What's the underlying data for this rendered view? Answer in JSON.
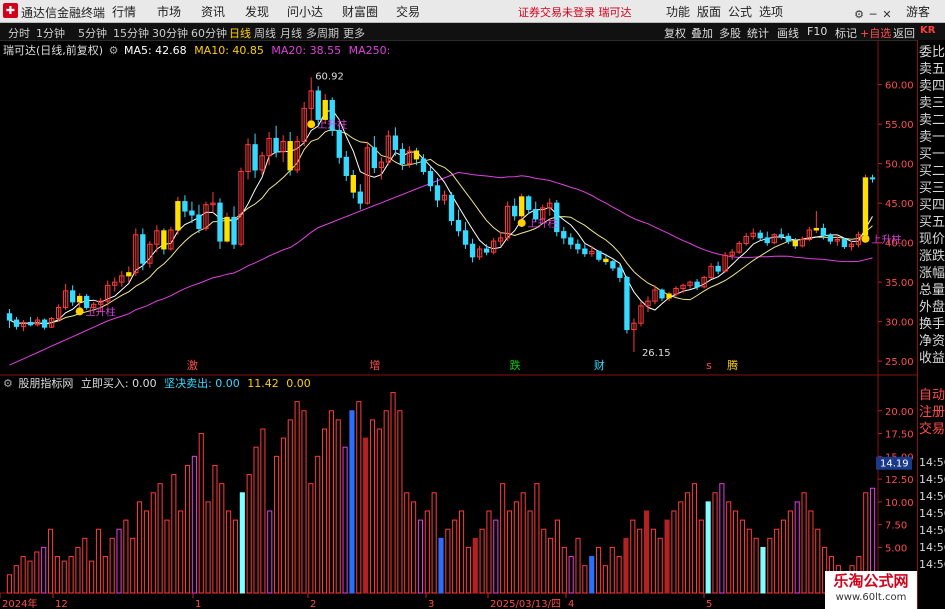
{
  "titlebar": {
    "app_name": "通达信金融终端",
    "menus": [
      "行情",
      "市场",
      "资讯",
      "发现",
      "问小达",
      "财富圈",
      "交易"
    ],
    "warning": "证券交易未登录  瑞可达",
    "right_menus": [
      "功能",
      "版面",
      "公式",
      "选项"
    ],
    "user": "游客"
  },
  "toolbar": {
    "periods": [
      "分时",
      "1分钟",
      "5分钟",
      "15分钟",
      "30分钟",
      "60分钟",
      "日线",
      "周线",
      "月线",
      "多周期",
      "更多"
    ],
    "active_period": "日线",
    "tools": [
      "复权",
      "叠加",
      "多股",
      "统计",
      "画线",
      "F10",
      "标记",
      "+自选",
      "返回"
    ]
  },
  "legend": {
    "stock": "瑞可达(日线,前复权)",
    "ma5": "MA5: 42.68",
    "ma10": "MA10: 40.85",
    "ma20": "MA20: 38.55",
    "ma250": "MA250:",
    "indicator_name": "股朋指标网",
    "buy": "立即买入: 0.00",
    "sell": "坚决卖出: 0.00",
    "extra1": "11.42",
    "extra2": "0.00"
  },
  "colors": {
    "up": "#ff3b3b",
    "down": "#36d9ff",
    "ma5": "#ffffff",
    "ma10": "#ffd000",
    "ma20": "#f0e68c",
    "ma250": "#e040e0",
    "signal": "#ffe000",
    "grid": "#8a1010"
  },
  "sidebar": {
    "code": "KR",
    "items": [
      "委比",
      "卖五",
      "卖四",
      "卖三",
      "卖二",
      "卖一",
      "买一",
      "买二",
      "买三",
      "买四",
      "买五",
      "现价",
      "涨跌",
      "涨幅",
      "总量",
      "外盘",
      "换手",
      "净资",
      "收益"
    ],
    "lower": [
      "自动",
      "注册",
      "交易"
    ],
    "price_box": "14.19",
    "times": [
      "14:56",
      "14:56",
      "14:56",
      "14:56",
      "14:56",
      "14:56",
      "14:56"
    ]
  },
  "watermark": {
    "line1": "乐淘公式网",
    "line2": "www.60lt.com"
  },
  "chart_data": [
    {
      "type": "candlestick",
      "title": "瑞可达(日线,前复权)",
      "ylim": [
        23.5,
        63.5
      ],
      "yticks": [
        25.0,
        30.0,
        35.0,
        40.0,
        45.0,
        50.0,
        55.0,
        60.0
      ],
      "annotations": [
        {
          "text": "60.92",
          "type": "high"
        },
        {
          "text": "26.15",
          "type": "low"
        },
        {
          "text": "上升柱",
          "type": "signal"
        }
      ],
      "event_labels": [
        "激",
        "增",
        "跌",
        "财",
        "s",
        "腾"
      ],
      "series": [
        {
          "name": "MA5",
          "values": [
            42.68
          ]
        },
        {
          "name": "MA10",
          "values": [
            40.85
          ]
        },
        {
          "name": "MA20",
          "values": [
            38.55
          ]
        },
        {
          "name": "MA250",
          "values": []
        }
      ],
      "ohlc": [
        [
          31.0,
          31.6,
          29.2,
          30.2
        ],
        [
          30.2,
          30.6,
          29.0,
          29.4
        ],
        [
          29.4,
          30.2,
          28.8,
          29.9
        ],
        [
          29.9,
          30.6,
          29.4,
          29.6
        ],
        [
          29.6,
          30.6,
          29.4,
          30.2
        ],
        [
          30.2,
          30.4,
          29.0,
          29.3
        ],
        [
          29.3,
          30.6,
          29.2,
          30.4
        ],
        [
          30.4,
          32.2,
          30.0,
          31.8
        ],
        [
          31.8,
          34.8,
          31.5,
          33.9
        ],
        [
          33.9,
          34.6,
          32.0,
          32.5
        ],
        [
          32.5,
          33.6,
          31.8,
          33.2
        ],
        [
          33.2,
          33.5,
          31.5,
          31.8
        ],
        [
          31.8,
          32.5,
          31.0,
          32.2
        ],
        [
          32.2,
          33.0,
          31.2,
          32.6
        ],
        [
          32.6,
          35.2,
          32.0,
          34.6
        ],
        [
          34.6,
          35.6,
          33.8,
          35.0
        ],
        [
          35.0,
          36.4,
          34.4,
          35.8
        ],
        [
          35.8,
          37.0,
          35.0,
          36.2
        ],
        [
          36.2,
          41.8,
          35.8,
          41.0
        ],
        [
          41.0,
          41.8,
          36.5,
          37.4
        ],
        [
          37.4,
          40.2,
          36.8,
          39.8
        ],
        [
          39.8,
          42.2,
          38.8,
          41.5
        ],
        [
          41.5,
          41.8,
          38.5,
          39.2
        ],
        [
          39.2,
          42.0,
          39.0,
          41.6
        ],
        [
          41.6,
          45.8,
          41.0,
          45.2
        ],
        [
          45.2,
          46.0,
          43.2,
          44.0
        ],
        [
          44.0,
          45.2,
          42.5,
          43.5
        ],
        [
          43.5,
          44.8,
          41.2,
          41.8
        ],
        [
          41.8,
          45.2,
          41.5,
          44.8
        ],
        [
          44.8,
          46.4,
          43.8,
          45.0
        ],
        [
          45.0,
          45.6,
          39.2,
          40.2
        ],
        [
          40.2,
          43.8,
          40.0,
          43.2
        ],
        [
          43.2,
          44.6,
          39.2,
          39.8
        ],
        [
          39.8,
          49.5,
          39.5,
          49.0
        ],
        [
          49.0,
          53.2,
          48.0,
          52.4
        ],
        [
          52.4,
          53.8,
          48.2,
          49.2
        ],
        [
          49.2,
          51.5,
          48.6,
          51.0
        ],
        [
          51.0,
          54.0,
          49.8,
          53.2
        ],
        [
          53.2,
          54.8,
          50.8,
          51.5
        ],
        [
          51.5,
          53.6,
          50.2,
          52.8
        ],
        [
          52.8,
          54.0,
          48.5,
          49.2
        ],
        [
          49.2,
          53.5,
          48.8,
          52.8
        ],
        [
          52.8,
          57.8,
          52.2,
          57.0
        ],
        [
          57.0,
          60.92,
          55.5,
          59.2
        ],
        [
          59.2,
          59.8,
          54.8,
          55.6
        ],
        [
          55.6,
          58.8,
          55.0,
          58.0
        ],
        [
          58.0,
          58.4,
          53.5,
          54.2
        ],
        [
          54.2,
          54.8,
          50.0,
          50.8
        ],
        [
          50.8,
          51.6,
          47.8,
          48.5
        ],
        [
          48.5,
          49.2,
          45.6,
          46.4
        ],
        [
          46.4,
          47.4,
          44.2,
          45.0
        ],
        [
          45.0,
          52.8,
          44.8,
          52.0
        ],
        [
          52.0,
          53.5,
          48.8,
          49.5
        ],
        [
          49.5,
          50.8,
          48.0,
          50.2
        ],
        [
          50.2,
          54.2,
          49.8,
          53.5
        ],
        [
          53.5,
          54.6,
          51.0,
          51.8
        ],
        [
          51.8,
          52.6,
          49.2,
          50.0
        ],
        [
          50.0,
          52.2,
          49.5,
          51.6
        ],
        [
          51.6,
          52.0,
          49.8,
          50.6
        ],
        [
          50.6,
          51.2,
          48.6,
          49.0
        ],
        [
          49.0,
          49.6,
          46.5,
          47.2
        ],
        [
          47.2,
          48.2,
          44.5,
          45.4
        ],
        [
          45.4,
          46.6,
          44.8,
          46.0
        ],
        [
          46.0,
          46.4,
          42.2,
          42.8
        ],
        [
          42.8,
          44.2,
          40.8,
          41.5
        ],
        [
          41.5,
          42.6,
          39.2,
          39.8
        ],
        [
          39.8,
          40.5,
          37.5,
          38.2
        ],
        [
          38.2,
          39.6,
          37.8,
          39.2
        ],
        [
          39.2,
          39.8,
          38.4,
          38.8
        ],
        [
          38.8,
          40.6,
          38.5,
          40.2
        ],
        [
          40.2,
          41.4,
          39.6,
          40.6
        ],
        [
          40.6,
          45.2,
          40.2,
          44.6
        ],
        [
          44.6,
          45.6,
          42.8,
          43.4
        ],
        [
          43.4,
          46.2,
          43.0,
          45.8
        ],
        [
          45.8,
          46.0,
          43.6,
          44.2
        ],
        [
          44.2,
          45.2,
          42.6,
          43.0
        ],
        [
          43.0,
          44.8,
          42.6,
          44.4
        ],
        [
          44.4,
          45.6,
          43.4,
          45.0
        ],
        [
          45.0,
          45.4,
          40.8,
          41.4
        ],
        [
          41.4,
          42.0,
          39.8,
          40.6
        ],
        [
          40.6,
          41.2,
          39.2,
          39.8
        ],
        [
          39.8,
          40.4,
          38.6,
          39.2
        ],
        [
          39.2,
          39.8,
          38.2,
          38.6
        ],
        [
          38.6,
          39.6,
          38.2,
          38.9
        ],
        [
          38.9,
          39.0,
          37.6,
          37.9
        ],
        [
          37.9,
          38.6,
          37.2,
          37.6
        ],
        [
          37.6,
          37.8,
          36.4,
          36.8
        ],
        [
          36.8,
          37.2,
          35.0,
          35.6
        ],
        [
          35.6,
          35.8,
          28.5,
          29.0
        ],
        [
          29.0,
          30.4,
          26.15,
          29.8
        ],
        [
          29.8,
          32.6,
          29.4,
          32.0
        ],
        [
          32.0,
          33.2,
          31.2,
          32.6
        ],
        [
          32.6,
          34.6,
          32.2,
          34.0
        ],
        [
          34.0,
          34.2,
          32.6,
          33.0
        ],
        [
          33.0,
          33.8,
          32.6,
          33.5
        ],
        [
          33.5,
          34.5,
          33.2,
          34.2
        ],
        [
          34.2,
          34.8,
          33.6,
          34.6
        ],
        [
          34.6,
          35.2,
          34.2,
          35.0
        ],
        [
          35.0,
          35.4,
          34.0,
          34.4
        ],
        [
          34.4,
          35.8,
          34.2,
          35.6
        ],
        [
          35.6,
          37.4,
          35.4,
          37.0
        ],
        [
          37.0,
          37.6,
          36.0,
          36.4
        ],
        [
          36.4,
          38.8,
          36.2,
          38.4
        ],
        [
          38.4,
          39.2,
          37.8,
          38.8
        ],
        [
          38.8,
          40.2,
          38.6,
          39.9
        ],
        [
          39.9,
          41.2,
          39.6,
          40.8
        ],
        [
          40.8,
          41.8,
          40.4,
          41.2
        ],
        [
          41.2,
          41.6,
          40.2,
          40.6
        ],
        [
          40.6,
          41.4,
          39.6,
          40.0
        ],
        [
          40.0,
          41.2,
          39.8,
          41.0
        ],
        [
          41.0,
          41.8,
          40.4,
          40.8
        ],
        [
          40.8,
          41.2,
          39.8,
          40.2
        ],
        [
          40.2,
          40.6,
          39.2,
          39.6
        ],
        [
          39.6,
          40.8,
          39.4,
          40.4
        ],
        [
          40.4,
          42.0,
          40.2,
          41.6
        ],
        [
          41.6,
          44.0,
          41.2,
          41.8
        ],
        [
          41.8,
          42.4,
          40.4,
          40.9
        ],
        [
          40.9,
          41.2,
          39.8,
          40.2
        ],
        [
          40.2,
          40.8,
          39.6,
          40.4
        ],
        [
          40.4,
          40.6,
          39.2,
          39.5
        ],
        [
          39.5,
          40.2,
          39.0,
          39.8
        ],
        [
          39.8,
          41.4,
          39.4,
          41.0
        ],
        [
          41.0,
          48.6,
          41.0,
          48.2
        ],
        [
          48.2,
          48.6,
          47.6,
          48.1
        ]
      ]
    },
    {
      "type": "bar",
      "title": "股朋指标网",
      "ylim": [
        0,
        22.5
      ],
      "yticks": [
        5.0,
        7.5,
        10.0,
        12.5,
        15.0,
        17.5,
        20.0
      ],
      "x_labels": [
        "2024年",
        "12",
        "1",
        "2",
        "3",
        "2025/03/13/四",
        "4",
        "5"
      ],
      "values": [
        2,
        3,
        4,
        3.5,
        4.5,
        5,
        7,
        4,
        3.5,
        4,
        5,
        6,
        3.5,
        7,
        4,
        6,
        7,
        8,
        6,
        10,
        9,
        11,
        12,
        8,
        13,
        9,
        14,
        15,
        17.5,
        10,
        14,
        12,
        9,
        8,
        11,
        13,
        16,
        18,
        9,
        15,
        17,
        19,
        21,
        20,
        12,
        15,
        18,
        20,
        19,
        16,
        20,
        21,
        17,
        19,
        18,
        20,
        22,
        20,
        11,
        10,
        8,
        9,
        11,
        6,
        7,
        8,
        9,
        5,
        6,
        7,
        9,
        8,
        12,
        9,
        10,
        11,
        9,
        12,
        7,
        6,
        8,
        5,
        4,
        6,
        3,
        4,
        5,
        3,
        5,
        4,
        6,
        8,
        7,
        9,
        7,
        6,
        8,
        9,
        10,
        11,
        12,
        8,
        10,
        11,
        12,
        10,
        9,
        8,
        7,
        6,
        5,
        6,
        7,
        8,
        9,
        10,
        11,
        9,
        7,
        5,
        4,
        3,
        2,
        3,
        4,
        11,
        11.5
      ]
    }
  ]
}
